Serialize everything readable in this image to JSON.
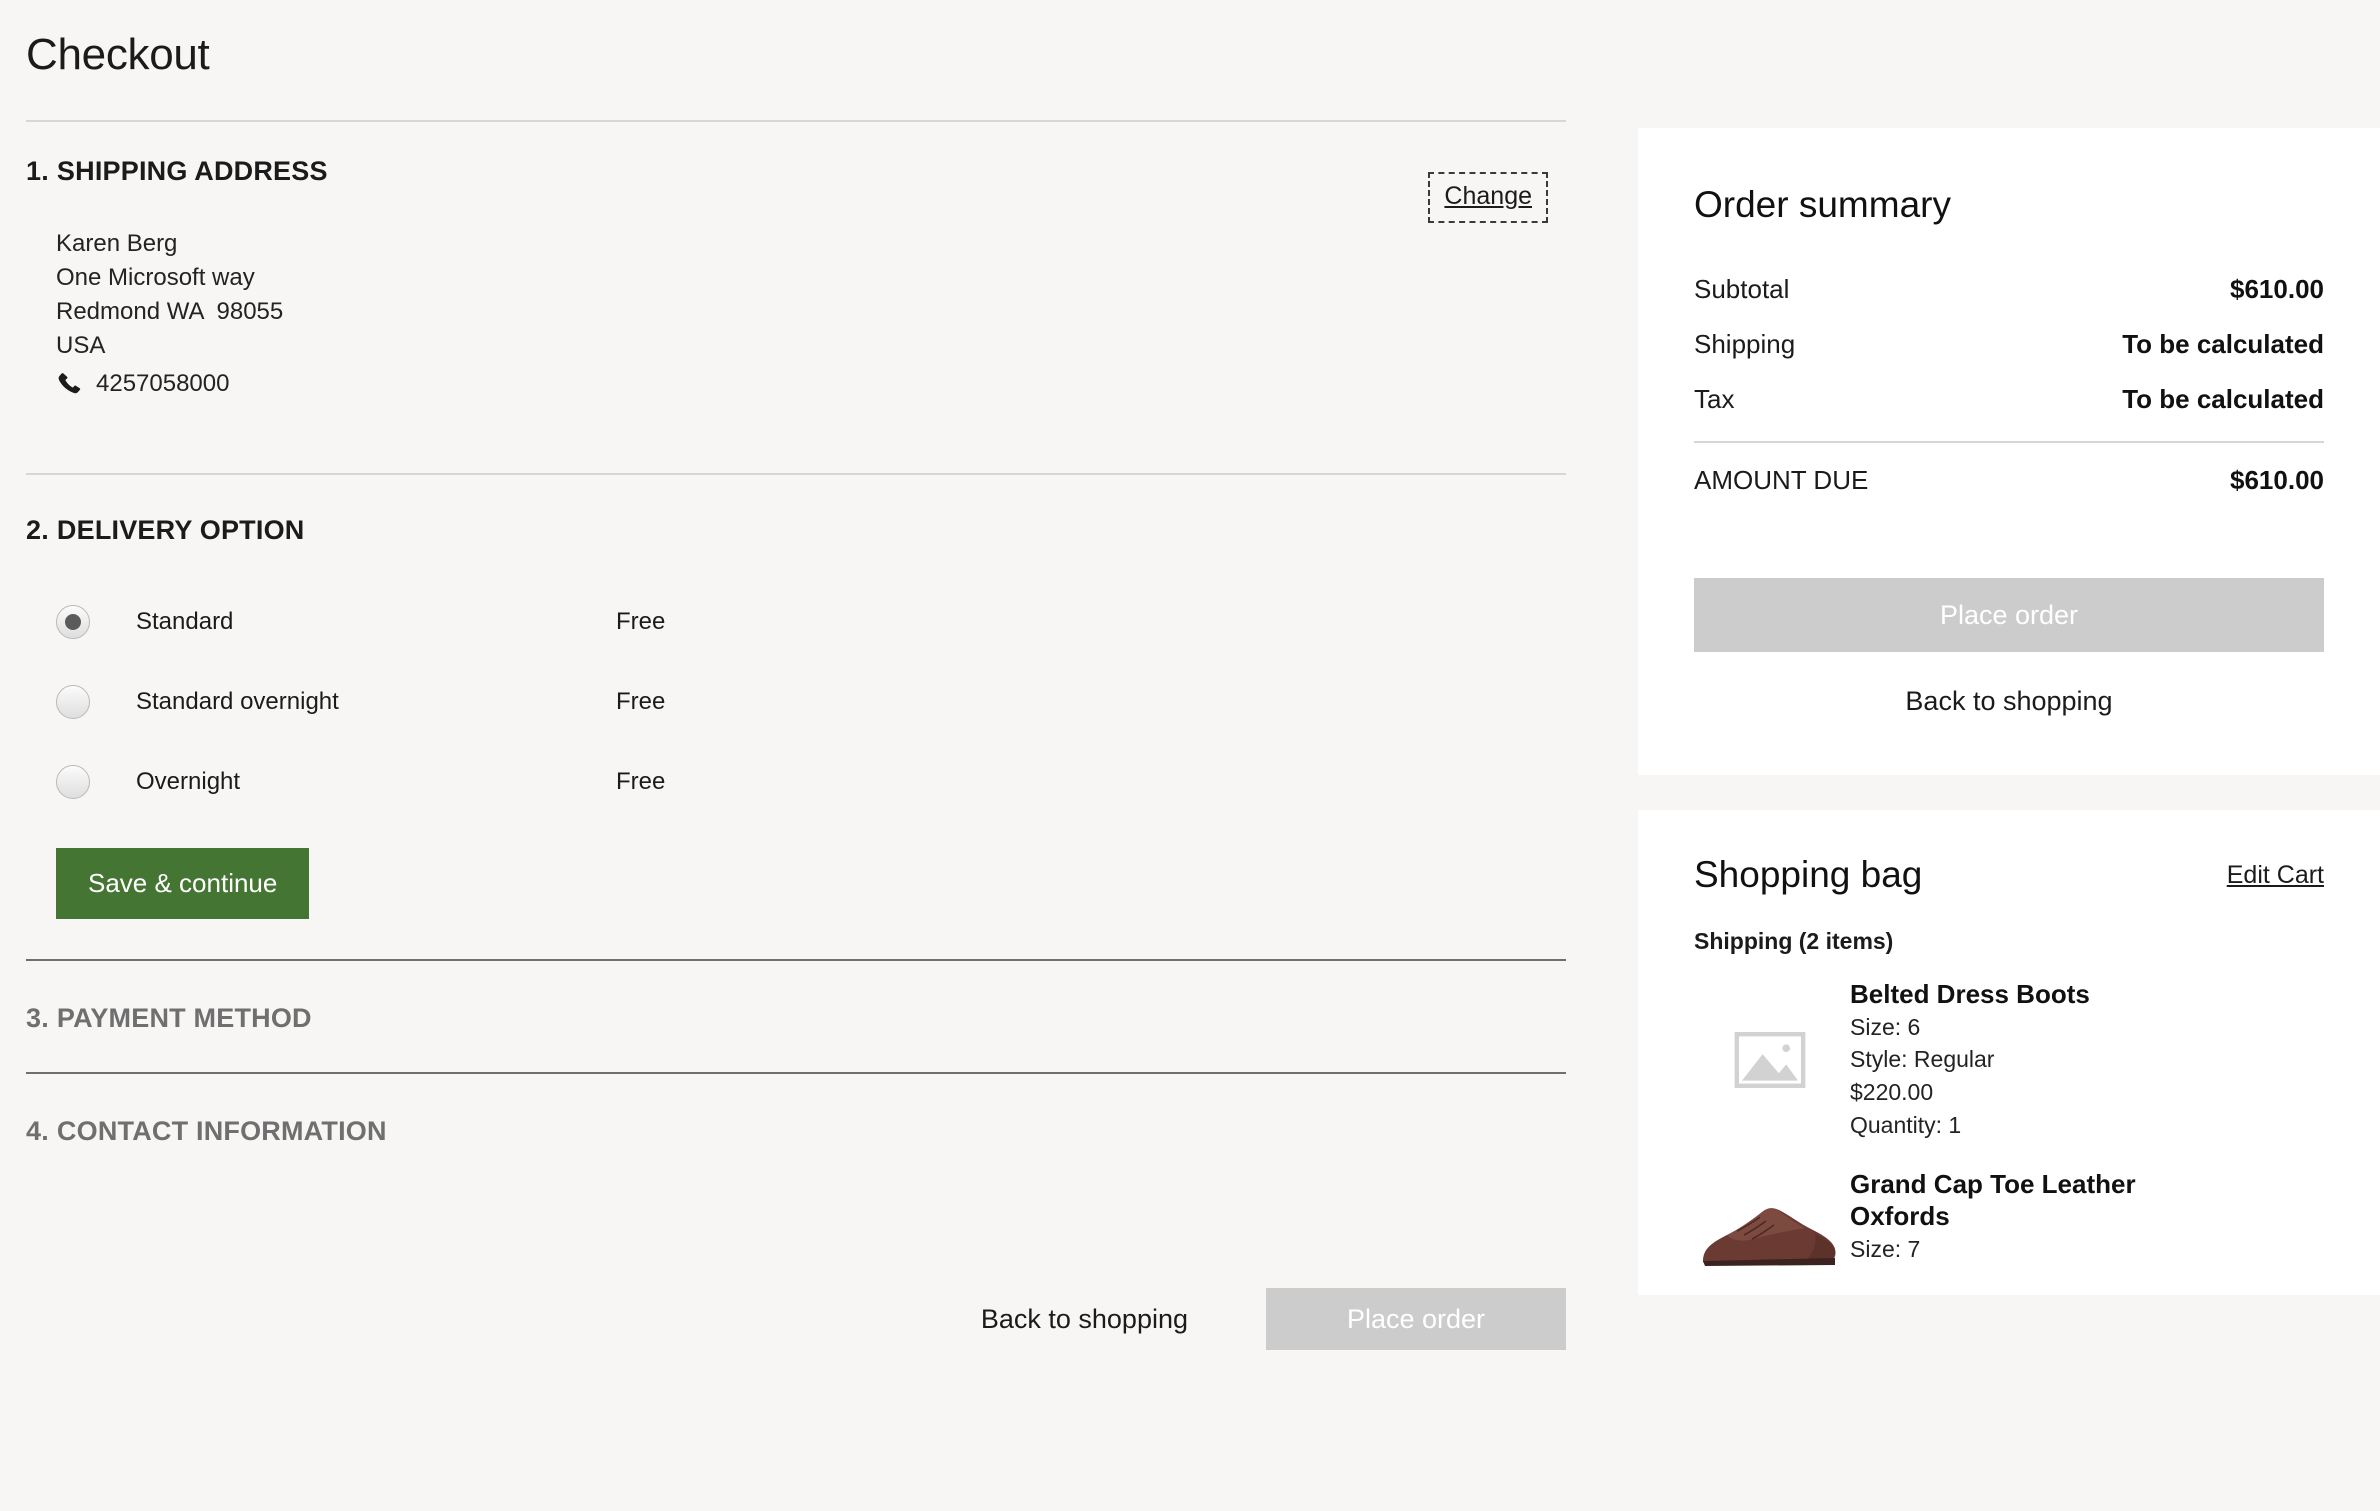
{
  "page": {
    "title": "Checkout"
  },
  "sections": {
    "shipping": {
      "number": "1.",
      "heading": "SHIPPING ADDRESS",
      "change_label": "Change",
      "address": {
        "name": "Karen Berg",
        "street": "One Microsoft way",
        "city_state_zip": "Redmond WA  98055",
        "country": "USA",
        "phone": "4257058000",
        "phone_icon": "phone-icon"
      }
    },
    "delivery": {
      "number": "2.",
      "heading": "DELIVERY OPTION",
      "options": [
        {
          "label": "Standard",
          "price": "Free",
          "selected": true
        },
        {
          "label": "Standard overnight",
          "price": "Free",
          "selected": false
        },
        {
          "label": "Overnight",
          "price": "Free",
          "selected": false
        }
      ],
      "save_label": "Save & continue"
    },
    "payment": {
      "number": "3.",
      "heading": "PAYMENT METHOD"
    },
    "contact": {
      "number": "4.",
      "heading": "CONTACT INFORMATION"
    }
  },
  "bottom_actions": {
    "back_label": "Back to shopping",
    "place_order_label": "Place order"
  },
  "order_summary": {
    "title": "Order summary",
    "rows": [
      {
        "label": "Subtotal",
        "value": "$610.00"
      },
      {
        "label": "Shipping",
        "value": "To be calculated"
      },
      {
        "label": "Tax",
        "value": "To be calculated"
      }
    ],
    "total": {
      "label": "AMOUNT DUE",
      "value": "$610.00"
    },
    "place_order_label": "Place order",
    "back_label": "Back to shopping"
  },
  "shopping_bag": {
    "title": "Shopping bag",
    "edit_label": "Edit Cart",
    "shipping_group": "Shipping (2 items)",
    "items": [
      {
        "name": "Belted Dress Boots",
        "size": "Size: 6",
        "style": "Style: Regular",
        "price": "$220.00",
        "quantity": "Quantity: 1",
        "image": "image-placeholder-icon"
      },
      {
        "name": "Grand Cap Toe Leather Oxfords",
        "size": "Size: 7",
        "image": "oxford-shoe-photo"
      }
    ]
  },
  "colors": {
    "page_bg": "#f7f6f4",
    "card_bg": "#ffffff",
    "accent_green": "#457533",
    "disabled_grey": "#cccccc",
    "inactive_text": "#6f6f6f"
  }
}
